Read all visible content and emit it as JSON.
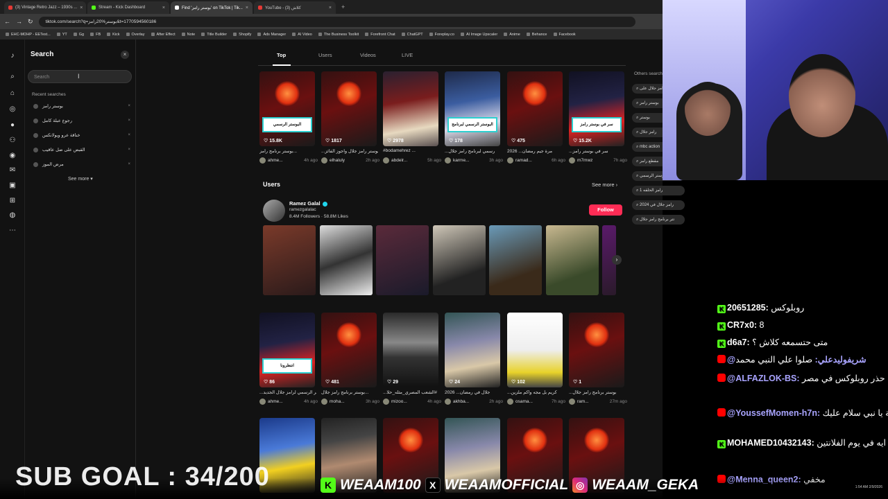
{
  "browser": {
    "tabs": [
      {
        "title": "(3) Vintage Retro Jazz – 1930s ...",
        "active": false,
        "color": "#e53935"
      },
      {
        "title": "Stream - Kick Dashboard",
        "active": false,
        "color": "#53fc18"
      },
      {
        "title": "Find 'بوستر رامز' on TikTok | Tik...",
        "active": true,
        "color": "#ffffff"
      },
      {
        "title": "YouTube - (3) كلاش",
        "active": false,
        "color": "#e53935"
      }
    ],
    "url": "tiktok.com/search?q=بوستر%20رامز&t=1770594560186",
    "bookmarks": [
      "EHC-MOHP - EETest...",
      "YT",
      "Gg",
      "FB",
      "Kick",
      "Overlay",
      "After Effect",
      "Note",
      "Title Builder",
      "Shopify",
      "Ads Manager",
      "AI Video",
      "The Business Toolkit",
      "Forefront Chat",
      "ChatGPT",
      "Foreplay.co",
      "AI Image Upscaler",
      "Anime",
      "Behance",
      "Facebook"
    ]
  },
  "search_panel": {
    "title": "Search",
    "placeholder": "Search",
    "recent_title": "Recent searches",
    "recent": [
      "بوستر رامز",
      "رجوع عبلة كامل",
      "خناقة عرو ويولانكس",
      "القبض على ضل عاقيب",
      "مرض الموز"
    ],
    "see_more": "See more"
  },
  "result_tabs": [
    "Top",
    "Users",
    "Videos",
    "LIVE"
  ],
  "others_searched": {
    "title": "Others searched",
    "items": [
      "رامز جلال على",
      "بوستر رامز",
      "بوستر",
      "رامز جلال",
      "mbc action",
      "مقطع رامز",
      "بوستر الرسمي",
      "رامز الحلقه 1",
      "رامز جلال في 2024",
      "تتر برنامج رامز جلال"
    ]
  },
  "top_videos": [
    {
      "likes": "15.8K",
      "caption": "بوستر برنامج رامز...",
      "user": "ahme...",
      "ago": "4h ago",
      "banner": "البوستر الرسمي"
    },
    {
      "likes": "1817",
      "caption": "...بوستر رامز جلال واجوز الفائز",
      "user": "elhaluly",
      "ago": "2h ago",
      "banner": ""
    },
    {
      "likes": "2978",
      "caption": "#bodamehrez ...",
      "user": "abdelr...",
      "ago": "5h ago",
      "banner": ""
    },
    {
      "likes": "178",
      "caption": "...رسمي لبرنامج رامز جلال",
      "user": "karme...",
      "ago": "3h ago",
      "banner": "البوستر الرسمي لبرنامج رامز"
    },
    {
      "likes": "475",
      "caption": "2026 ...مرة جيم رمضان",
      "user": "ramad...",
      "ago": "6h ago",
      "banner": ""
    },
    {
      "likes": "15.2K",
      "caption": "...سر في بوستر رامز",
      "user": "m7mwz",
      "ago": "7h ago",
      "banner": "سر في بوستر رامز"
    }
  ],
  "users_section": {
    "heading": "Users",
    "see_more": "See more",
    "name": "Ramez Galal",
    "handle": "ramezgalalac",
    "stats": "8.4M Followers · 58.8M Likes",
    "follow": "Follow"
  },
  "grid_videos": [
    {
      "likes": "86",
      "caption": "...البوستر الرسمي لرامز جلال الجديد",
      "user": "ahme...",
      "ago": "4h ago",
      "banner": "انتظرونا"
    },
    {
      "likes": "481",
      "caption": "بوستر برنامج رامز جلال...",
      "user": "moha...",
      "ago": "3h ago",
      "banner": ""
    },
    {
      "likes": "29",
      "caption": "...الشعب المصري_مثله_حلا#",
      "user": "mizoo...",
      "ago": "4h ago",
      "banner": ""
    },
    {
      "likes": "24",
      "caption": "2026 ...جلال في رمضان",
      "user": "akhba...",
      "ago": "2h ago",
      "banner": ""
    },
    {
      "likes": "102",
      "caption": "...كريم بل مجه واكم ملزين",
      "user": "osama...",
      "ago": "7h ago",
      "banner": ""
    },
    {
      "likes": "1",
      "caption": "...بوستر برنامج رامز جلال",
      "user": "ram...",
      "ago": "27m ago",
      "banner": ""
    }
  ],
  "stream": {
    "chat": [
      {
        "platform": "kick",
        "user": "20651285:",
        "text": " روبلوكس",
        "color": "#ffffff"
      },
      {
        "platform": "kick",
        "user": "CR7x0:",
        "text": " 8",
        "color": "#ffffff"
      },
      {
        "platform": "kick",
        "user": "d6a7:",
        "text": " متى حتسمعه كلاش ؟",
        "color": "#ffffff"
      },
      {
        "platform": "yt",
        "user": "@شريفوليدعلي:",
        "text": " صلوا علي النبي محمد",
        "color": "#a9a4ff"
      },
      {
        "platform": "yt",
        "user": "@ALFAZLOK-BS:",
        "text": " حذر روبلوكس في مصر",
        "color": "#a9a4ff"
      },
      {
        "platform": "yt",
        "user": "@YoussefMomen-h7n:",
        "text": " كلم عن اغنية يا نبي سلام عليك",
        "color": "#a9a4ff"
      },
      {
        "platform": "kick",
        "user": "MOHAMED10432143:",
        "text": " هتعمل ايه في يوم الفلانتين",
        "color": "#ffffff"
      },
      {
        "platform": "yt",
        "user": "@Menna_queen2:",
        "text": " مخفي",
        "color": "#a9a4ff"
      }
    ],
    "sub_goal": "SUB GOAL : 34/200",
    "socials": [
      "WEAAM100",
      "WEAAMOFFICIAL",
      "WEAAM_GEKA"
    ],
    "clock": "1:54 AM 2/9/2026"
  }
}
